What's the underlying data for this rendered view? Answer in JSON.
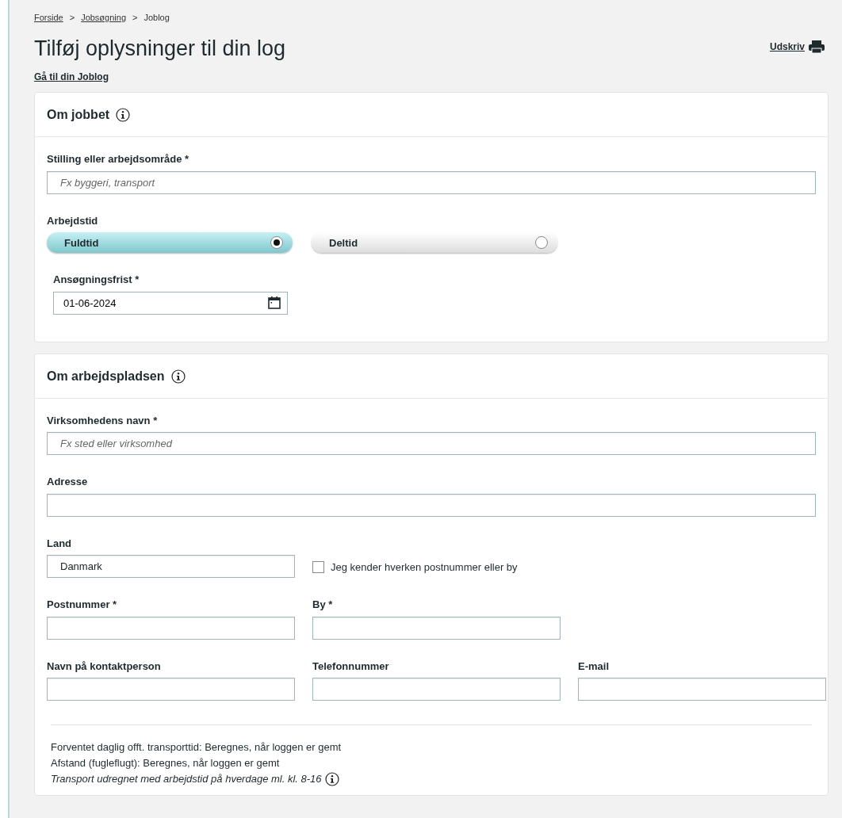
{
  "breadcrumb": [
    {
      "label": "Forside",
      "kind": "link"
    },
    {
      "label": "Jobsøgning",
      "kind": "link",
      "separator": ">"
    },
    {
      "label": "Joblog",
      "kind": "current",
      "separator": ">"
    }
  ],
  "page_title": "Tilføj oplysninger til din log",
  "print_link": "Udskriv",
  "back_link": "Gå til din Joblog",
  "sections": [
    {
      "title": "Om jobbet",
      "rows": [
        [
          {
            "kind": "text",
            "label": "Stilling eller arbejdsområde *",
            "placeholder": "Fx byggeri, transport"
          }
        ],
        [
          {
            "kind": "radio-group",
            "label": "Arbejdstid",
            "options": [
              {
                "label": "Fuldtid",
                "selected": true
              },
              {
                "label": "Deltid",
                "selected": false
              }
            ]
          }
        ],
        [
          {
            "kind": "date",
            "label": "Ansøgningsfrist *",
            "value": "01-06-2024"
          }
        ]
      ]
    },
    {
      "title": "Om arbejdspladsen",
      "rows": [
        [
          {
            "kind": "text",
            "label": "Virksomhedens navn *",
            "placeholder": "Fx sted eller virksomhed"
          }
        ],
        [
          {
            "kind": "text",
            "label": "Adresse"
          }
        ],
        [
          {
            "kind": "text",
            "label": "Land",
            "value": "Danmark"
          },
          {
            "kind": "checkbox",
            "label": "Jeg kender hverken postnummer eller by",
            "checked": false
          }
        ],
        [
          {
            "kind": "text",
            "label": "Postnummer *"
          },
          {
            "kind": "text",
            "label": "By *"
          }
        ],
        [
          {
            "kind": "text",
            "label": "Navn på kontaktperson"
          },
          {
            "kind": "text",
            "label": "Telefonnummer"
          },
          {
            "kind": "text",
            "label": "E-mail"
          }
        ]
      ],
      "notes": [
        {
          "kind": "plain",
          "text": "Forventet daglig offt. transporttid: Beregnes, når loggen er gemt"
        },
        {
          "kind": "plain",
          "text": "Afstand (fugleflugt): Beregnes, når loggen er gemt"
        },
        {
          "kind": "hint",
          "text": "Transport udregnet med arbejdstid på hverdage ml. kl. 8-16"
        }
      ]
    }
  ]
}
